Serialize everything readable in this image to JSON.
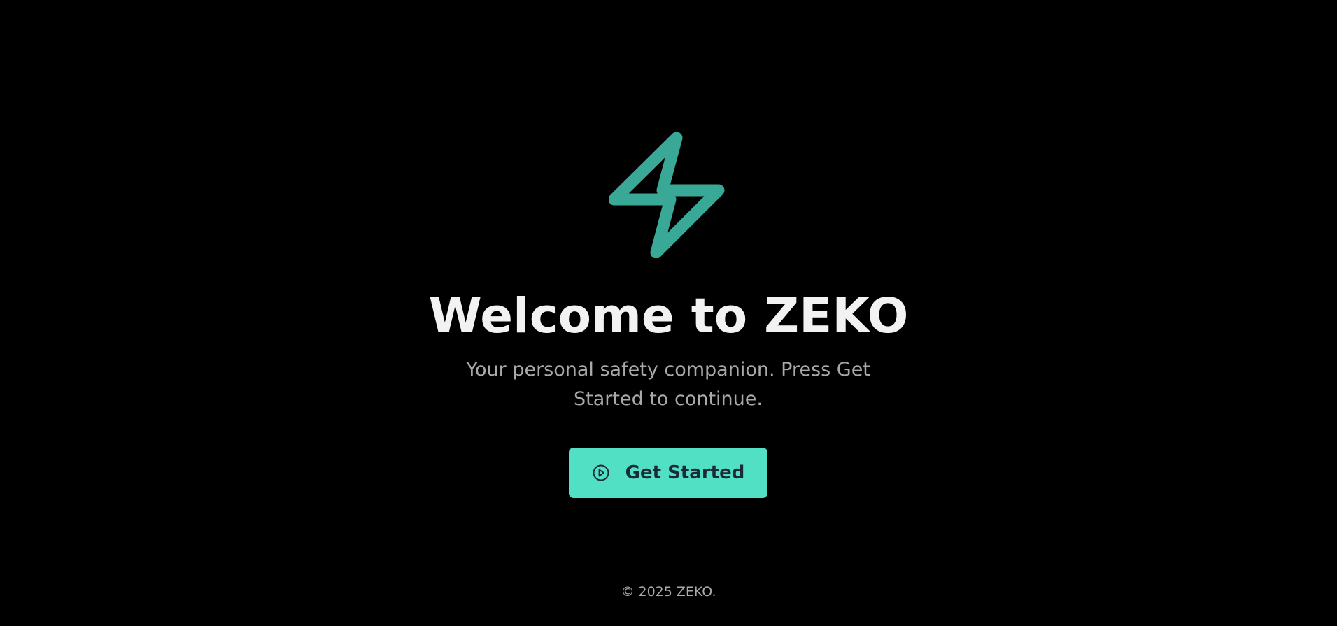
{
  "logo": {
    "icon": "lightning-bolt-icon",
    "color": "#3aa896"
  },
  "heading": {
    "title": "Welcome to ZEKO"
  },
  "intro": {
    "subtitle": "Your personal safety companion. Press Get Started to continue."
  },
  "cta": {
    "label": "Get Started",
    "icon": "play-circle-icon",
    "background": "#52e0c4",
    "text_color": "#1b2a3a"
  },
  "footer": {
    "copyright": "© 2025 ZEKO."
  }
}
